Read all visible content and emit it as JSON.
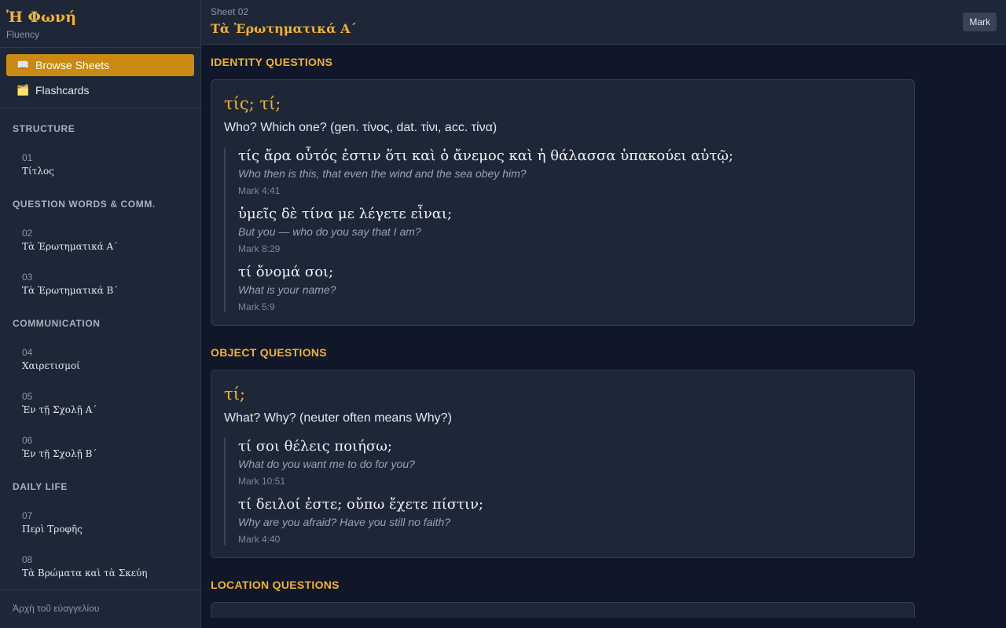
{
  "brand": {
    "title": "Ἡ Φωνή",
    "subtitle": "Fluency"
  },
  "nav": [
    {
      "icon": "📖",
      "label": "Browse Sheets"
    },
    {
      "icon": "🗂️",
      "label": "Flashcards"
    }
  ],
  "sidebar_sections": [
    {
      "heading": "STRUCTURE",
      "sheets": [
        {
          "num": "01",
          "name": "Τίτλος"
        }
      ]
    },
    {
      "heading": "QUESTION WORDS & COMM.",
      "sheets": [
        {
          "num": "02",
          "name": "Τὰ Ἐρωτηματικά Α´"
        },
        {
          "num": "03",
          "name": "Τὰ Ἐρωτηματικά Β´"
        }
      ]
    },
    {
      "heading": "COMMUNICATION",
      "sheets": [
        {
          "num": "04",
          "name": "Χαιρετισμοί"
        },
        {
          "num": "05",
          "name": "Ἐν τῇ Σχολῇ Α´"
        },
        {
          "num": "06",
          "name": "Ἐν τῇ Σχολῇ Β´"
        }
      ]
    },
    {
      "heading": "DAILY LIFE",
      "sheets": [
        {
          "num": "07",
          "name": "Περὶ Τροφῆς"
        },
        {
          "num": "08",
          "name": "Τὰ Βρώματα καὶ τὰ Σκεύη"
        }
      ]
    }
  ],
  "sidebar_footer": "Ἀρχὴ τοῦ εὐαγγελίου",
  "topbar": {
    "kicker": "Sheet 02",
    "title": "Τὰ Ἐρωτηματικά Α´",
    "mark_label": "Mark"
  },
  "groups": [
    {
      "heading": "IDENTITY QUESTIONS",
      "word": "τίς; τί;",
      "gloss": "Who? Which one? (gen. τίνος, dat. τίνι, acc. τίνα)",
      "examples": [
        {
          "greek": "τίς ἄρα οὗτός ἐστιν ὅτι καὶ ὁ ἄνεμος καὶ ἡ θάλασσα ὑπακούει αὐτῷ;",
          "translation": "Who then is this, that even the wind and the sea obey him?",
          "ref": "Mark 4:41"
        },
        {
          "greek": "ὑμεῖς δὲ τίνα με λέγετε εἶναι;",
          "translation": "But you — who do you say that I am?",
          "ref": "Mark 8:29"
        },
        {
          "greek": "τί ὄνομά σοι;",
          "translation": "What is your name?",
          "ref": "Mark 5:9"
        }
      ]
    },
    {
      "heading": "OBJECT QUESTIONS",
      "word": "τί;",
      "gloss": "What? Why? (neuter often means Why?)",
      "examples": [
        {
          "greek": "τί σοι θέλεις ποιήσω;",
          "translation": "What do you want me to do for you?",
          "ref": "Mark 10:51"
        },
        {
          "greek": "τί δειλοί ἐστε; οὔπω ἔχετε πίστιν;",
          "translation": "Why are you afraid? Have you still no faith?",
          "ref": "Mark 4:40"
        }
      ]
    }
  ],
  "next_group_heading": "LOCATION QUESTIONS"
}
